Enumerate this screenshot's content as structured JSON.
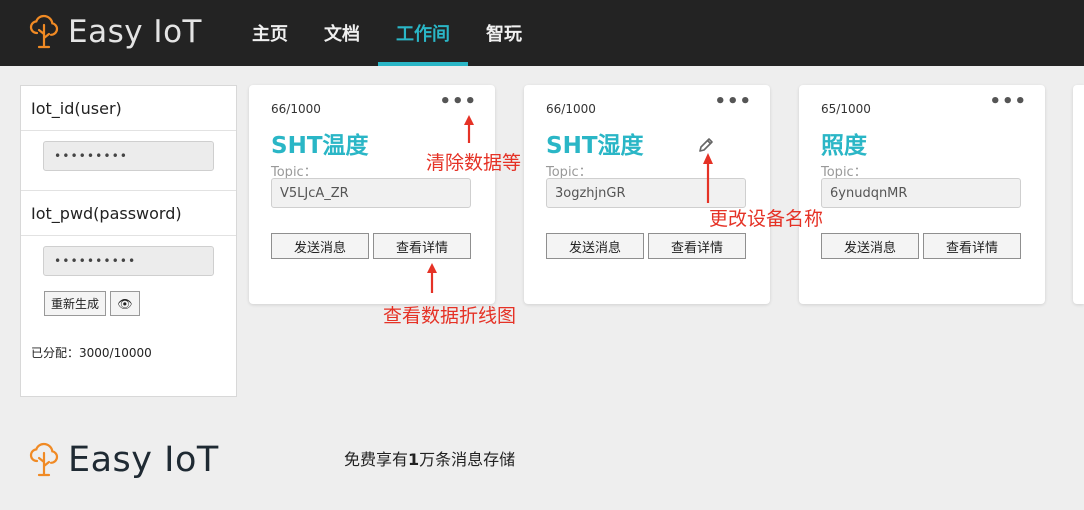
{
  "app": {
    "brand": "Easy IoT"
  },
  "nav": [
    {
      "label": "主页"
    },
    {
      "label": "文档"
    },
    {
      "label": "工作间"
    },
    {
      "label": "智玩"
    }
  ],
  "credentials": {
    "id_title": "Iot_id(user)",
    "id_value": "•••••••••",
    "pwd_title": "Iot_pwd(password)",
    "pwd_value": "••••••••••",
    "regenerate_label": "重新生成",
    "eye_icon": "👁",
    "allocated": "已分配：3000/10000"
  },
  "cards": [
    {
      "count": "66/1000",
      "name": "SHT温度",
      "topic_label": "Topic：",
      "topic": "V5LJcA_ZR",
      "send_label": "发送消息",
      "detail_label": "查看详情",
      "dots": "•••"
    },
    {
      "count": "66/1000",
      "name": "SHT湿度",
      "topic_label": "Topic：",
      "topic": "3ogzhjnGR",
      "send_label": "发送消息",
      "detail_label": "查看详情",
      "dots": "•••"
    },
    {
      "count": "65/1000",
      "name": "照度",
      "topic_label": "Topic：",
      "topic": "6ynudqnMR",
      "send_label": "发送消息",
      "detail_label": "查看详情",
      "dots": "•••"
    }
  ],
  "annotations": {
    "clear_data": "清除数据等",
    "rename_device": "更改设备名称",
    "view_chart": "查看数据折线图"
  },
  "footer": {
    "brand": "Easy IoT",
    "note_prefix": "免费享有",
    "note_bold": "1",
    "note_suffix": "万条消息存储"
  },
  "colors": {
    "accent": "#2ab6c6",
    "topbar": "#232323",
    "annotation": "#e53226",
    "brand_icon": "#f08a24"
  }
}
